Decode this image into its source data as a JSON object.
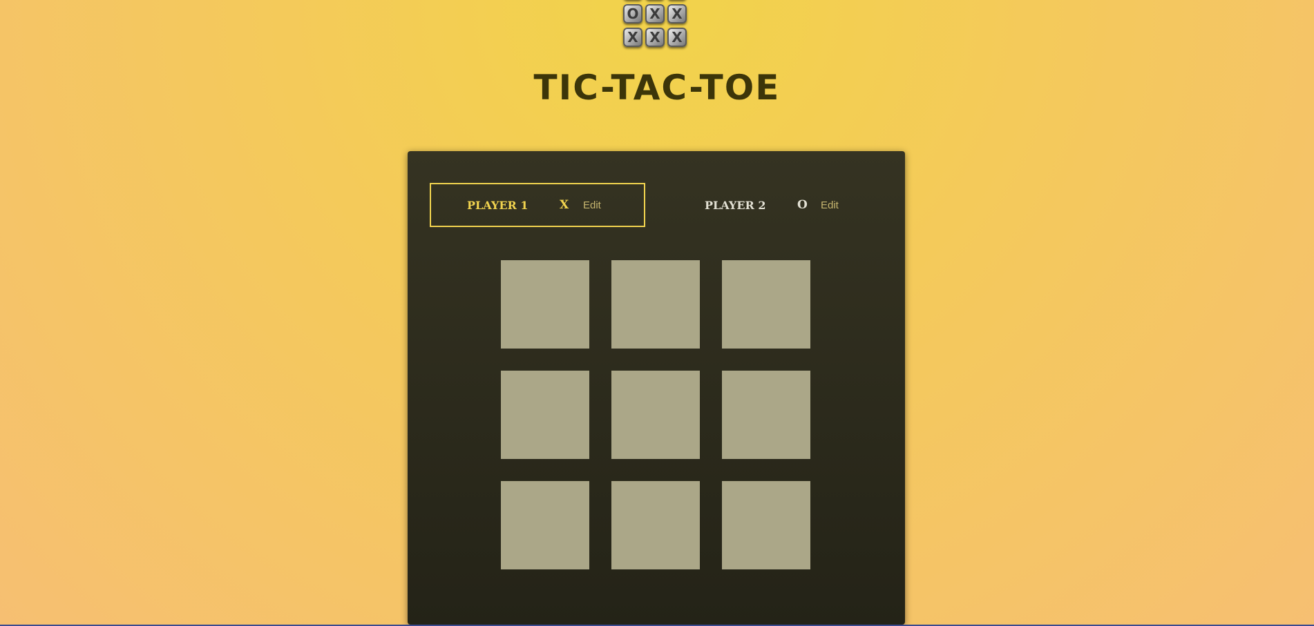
{
  "logo": {
    "tiles": [
      "",
      "",
      "",
      "O",
      "X",
      "X",
      "X",
      "X",
      "X"
    ]
  },
  "game": {
    "title": "TIC-TAC-TOE",
    "players": [
      {
        "name": "PLAYER 1",
        "symbol": "X",
        "edit_label": "Edit",
        "active": true
      },
      {
        "name": "PLAYER 2",
        "symbol": "O",
        "edit_label": "Edit",
        "active": false
      }
    ],
    "board": [
      "",
      "",
      "",
      "",
      "",
      "",
      "",
      "",
      ""
    ]
  },
  "colors": {
    "active_highlight": "#f2d44f",
    "cell": "#aba788",
    "panel": "#2f2d1f",
    "title": "#3c3509"
  }
}
